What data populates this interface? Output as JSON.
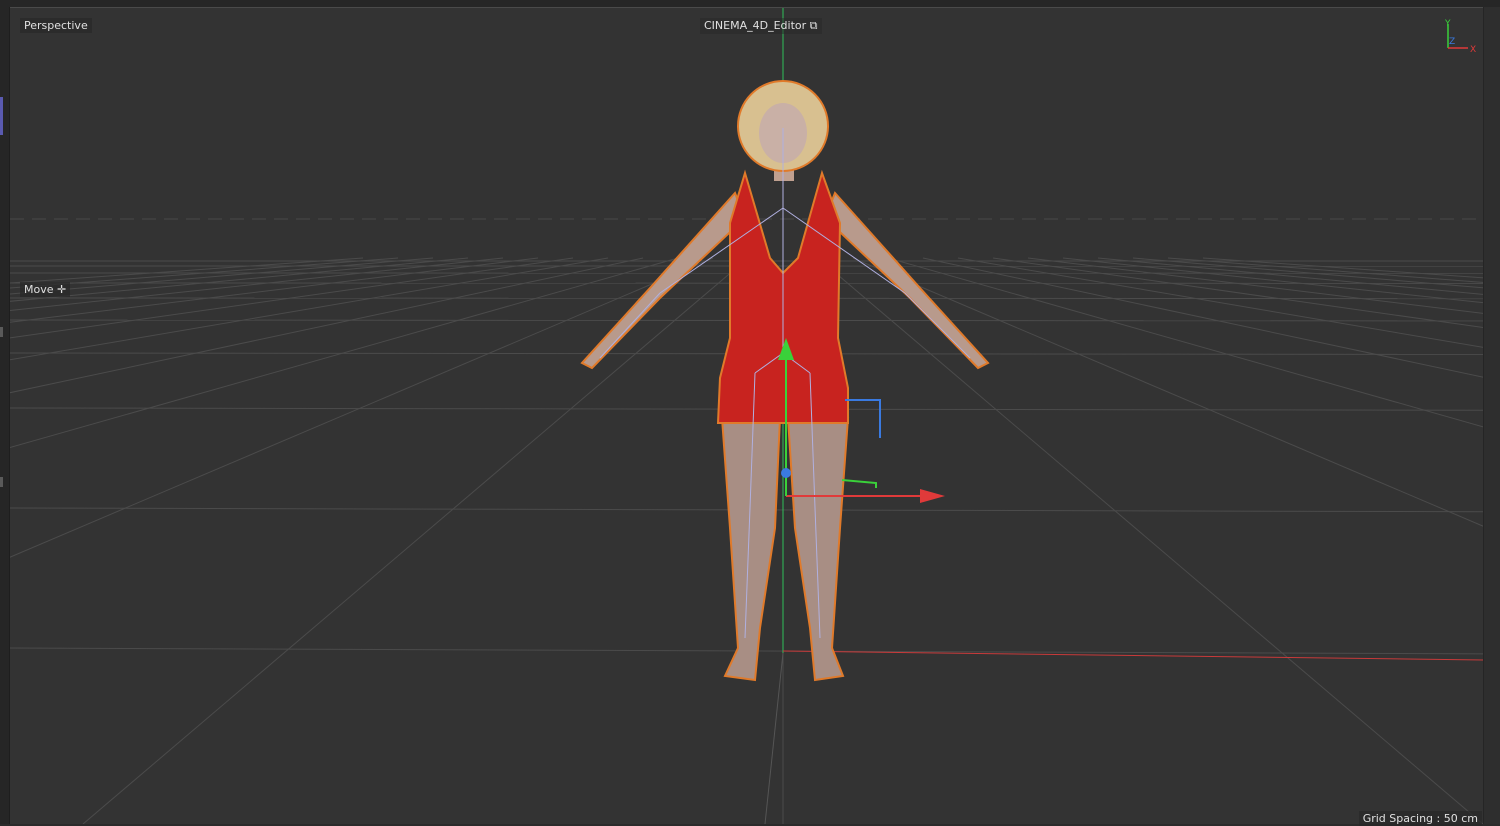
{
  "viewport": {
    "camera_label": "Perspective",
    "title": "CINEMA_4D_Editor",
    "tool_label": "Move",
    "grid_spacing": "Grid Spacing : 50 cm",
    "axis_labels": {
      "x": "X",
      "y": "Y",
      "z": "Z"
    }
  },
  "colors": {
    "background": "#333333",
    "x_axis": "#e03a3a",
    "y_axis": "#3ad13a",
    "z_axis": "#3a7ae0",
    "selection_outline": "#e07a2a",
    "dress": "#c8231f"
  }
}
